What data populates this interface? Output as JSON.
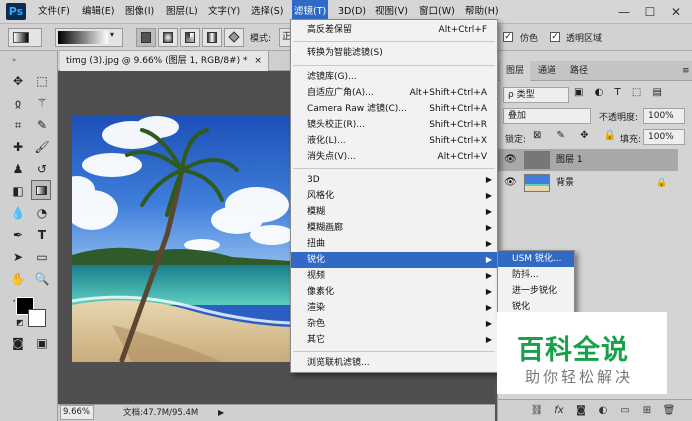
{
  "app": {
    "logo": "Ps"
  },
  "menubar": {
    "items": [
      "文件(F)",
      "编辑(E)",
      "图像(I)",
      "图层(L)",
      "文字(Y)",
      "选择(S)",
      "滤镜(T)",
      "3D(D)",
      "视图(V)",
      "窗口(W)",
      "帮助(H)"
    ],
    "window_controls": {
      "minimize": "—",
      "maximize": "☐",
      "close": "✕"
    }
  },
  "options": {
    "mode_label": "模式:",
    "mode_value": "正",
    "reverse_label": "仿色",
    "transparency_label": "透明区域"
  },
  "document": {
    "tab_title": "timg (3).jpg @ 9.66% (图层 1, RGB/8#) *",
    "tab_close": "×"
  },
  "status": {
    "zoom": "9.66%",
    "doc_size": "文档:47.7M/95.4M"
  },
  "layers_panel": {
    "tabs": [
      "图层",
      "通道",
      "路径"
    ],
    "filter_label": "ρ 类型",
    "blend_mode": "叠加",
    "opacity_label": "不透明度:",
    "opacity_value": "100%",
    "lock_label": "锁定:",
    "fill_label": "填充:",
    "fill_value": "100%",
    "layers": [
      {
        "name": "图层 1"
      },
      {
        "name": "背景"
      }
    ],
    "footer_icons": [
      "link-icon",
      "fx-icon",
      "mask-icon",
      "adjustment-icon",
      "folder-icon",
      "new-layer-icon",
      "trash-icon"
    ]
  },
  "filter_menu": {
    "top": [
      {
        "label": "高反差保留",
        "shortcut": "Alt+Ctrl+F"
      }
    ],
    "group1": [
      {
        "label": "转换为智能滤镜(S)",
        "shortcut": ""
      }
    ],
    "group2": [
      {
        "label": "滤镜库(G)...",
        "shortcut": ""
      },
      {
        "label": "自适应广角(A)...",
        "shortcut": "Alt+Shift+Ctrl+A"
      },
      {
        "label": "Camera Raw 滤镜(C)...",
        "shortcut": "Shift+Ctrl+A"
      },
      {
        "label": "镜头校正(R)...",
        "shortcut": "Shift+Ctrl+R"
      },
      {
        "label": "液化(L)...",
        "shortcut": "Shift+Ctrl+X"
      },
      {
        "label": "消失点(V)...",
        "shortcut": "Alt+Ctrl+V"
      }
    ],
    "group3": [
      "3D",
      "风格化",
      "模糊",
      "模糊画廊",
      "扭曲",
      "锐化",
      "视频",
      "像素化",
      "渲染",
      "杂色",
      "其它"
    ],
    "group4": [
      {
        "label": "浏览联机滤镜...",
        "shortcut": ""
      }
    ]
  },
  "sharpen_submenu": [
    "USM 锐化...",
    "防抖...",
    "进一步锐化",
    "锐化"
  ],
  "watermark": {
    "main": "百科全说",
    "sub": "助你轻松解决"
  },
  "colors": {
    "menu_highlight": "#316ac5",
    "watermark_green": "#18a04a"
  }
}
